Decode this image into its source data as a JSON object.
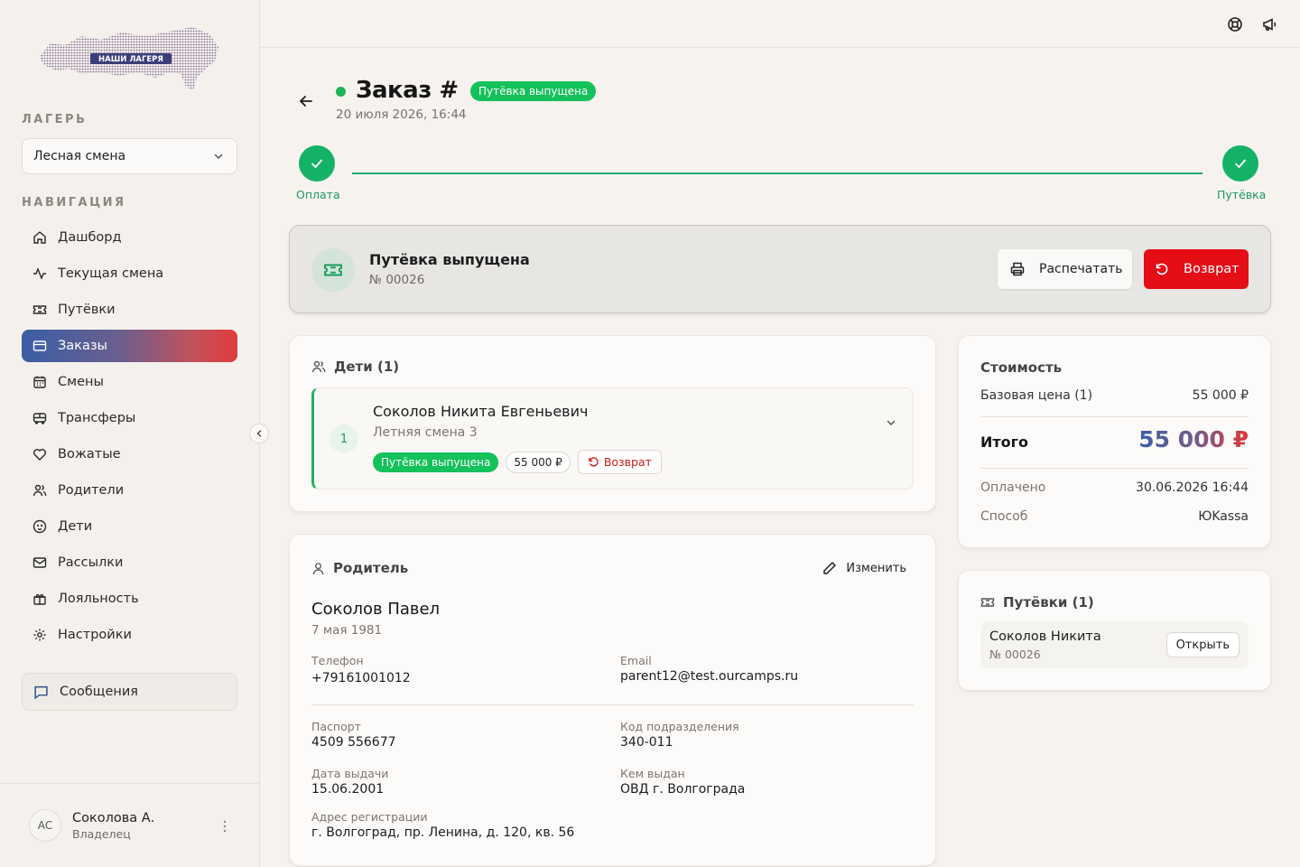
{
  "app": {
    "logo_text": "НАШИ ЛАГЕРЯ"
  },
  "sidebar": {
    "camp_label": "ЛАГЕРЬ",
    "camp_value": "Лесная смена",
    "nav_label": "НАВИГАЦИЯ",
    "items": [
      {
        "label": "Дашборд",
        "icon": "home-icon"
      },
      {
        "label": "Текущая смена",
        "icon": "activity-icon"
      },
      {
        "label": "Путёвки",
        "icon": "ticket-icon"
      },
      {
        "label": "Заказы",
        "icon": "card-icon",
        "active": true
      },
      {
        "label": "Смены",
        "icon": "calendar-icon"
      },
      {
        "label": "Трансферы",
        "icon": "bus-icon"
      },
      {
        "label": "Вожатые",
        "icon": "heart-icon"
      },
      {
        "label": "Родители",
        "icon": "users-icon"
      },
      {
        "label": "Дети",
        "icon": "baby-icon"
      },
      {
        "label": "Рассылки",
        "icon": "mail-icon"
      },
      {
        "label": "Лояльность",
        "icon": "gift-icon"
      },
      {
        "label": "Настройки",
        "icon": "gear-icon"
      }
    ],
    "messages_label": "Сообщения",
    "user": {
      "initials": "АС",
      "name": "Соколова А.",
      "role": "Владелец"
    }
  },
  "order": {
    "title": "Заказ #",
    "status_badge": "Путёвка выпущена",
    "date": "20 июля 2026, 16:44",
    "steps": [
      {
        "label": "Оплата",
        "done": true
      },
      {
        "label": "Путёвка",
        "done": true
      }
    ]
  },
  "banner": {
    "title": "Путёвка выпущена",
    "number": "№ 00026",
    "print_label": "Распечатать",
    "refund_label": "Возврат"
  },
  "children": {
    "header": "Дети (1)",
    "items": [
      {
        "index": "1",
        "name": "Соколов Никита Евгеньевич",
        "shift": "Летняя смена 3",
        "status": "Путёвка выпущена",
        "price": "55 000 ₽",
        "refund_label": "Возврат"
      }
    ]
  },
  "parent": {
    "header": "Родитель",
    "edit_label": "Изменить",
    "name": "Соколов Павел",
    "dob": "7 мая 1981",
    "phone_label": "Телефон",
    "phone": "+79161001012",
    "email_label": "Email",
    "email": "parent12@test.ourcamps.ru",
    "passport_label": "Паспорт",
    "passport": "4509 556677",
    "dept_code_label": "Код подразделения",
    "dept_code": "340-011",
    "issue_date_label": "Дата выдачи",
    "issue_date": "15.06.2001",
    "issued_by_label": "Кем выдан",
    "issued_by": "ОВД г. Волгограда",
    "address_label": "Адрес регистрации",
    "address": "г. Волгоград, пр. Ленина, д. 120, кв. 56"
  },
  "cost": {
    "header": "Стоимость",
    "base_label": "Базовая цена (1)",
    "base_value": "55 000 ₽",
    "total_label": "Итого",
    "total_value": "55 000 ₽",
    "paid_label": "Оплачено",
    "paid_value": "30.06.2026 16:44",
    "method_label": "Способ",
    "method_value": "ЮKassa"
  },
  "tickets": {
    "header": "Путёвки (1)",
    "items": [
      {
        "name": "Соколов Никита",
        "number": "№ 00026",
        "open_label": "Открыть"
      }
    ]
  },
  "colors": {
    "accent_green": "#14c15a",
    "danger_red": "#e50d16",
    "brand_blue": "#3b5fa8"
  }
}
